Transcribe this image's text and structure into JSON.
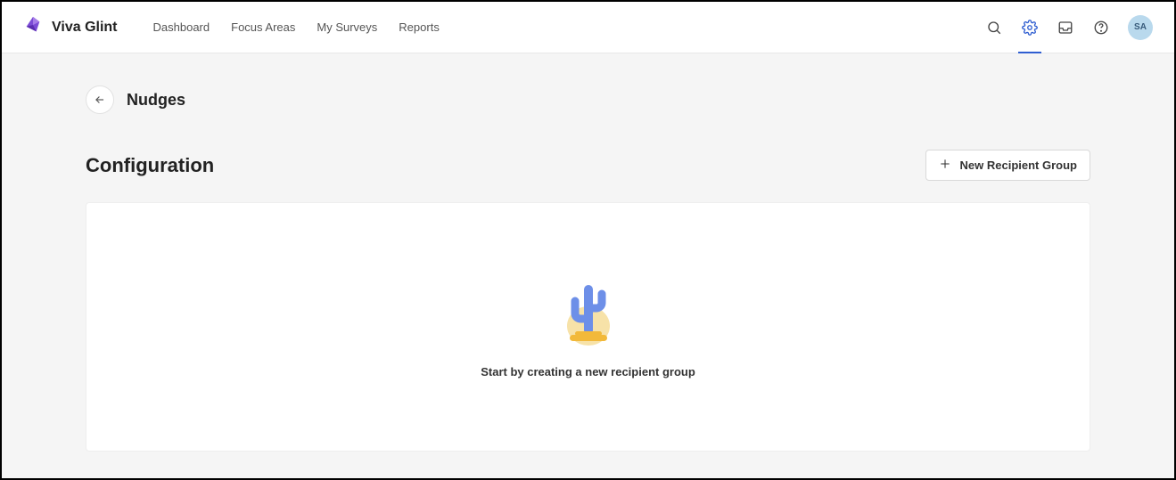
{
  "brand": {
    "name": "Viva Glint"
  },
  "nav": {
    "items": [
      {
        "label": "Dashboard"
      },
      {
        "label": "Focus Areas"
      },
      {
        "label": "My Surveys"
      },
      {
        "label": "Reports"
      }
    ]
  },
  "user": {
    "initials": "SA"
  },
  "page": {
    "title": "Nudges",
    "section_heading": "Configuration",
    "new_group_label": "New Recipient Group",
    "empty_message": "Start by creating a new recipient group"
  }
}
